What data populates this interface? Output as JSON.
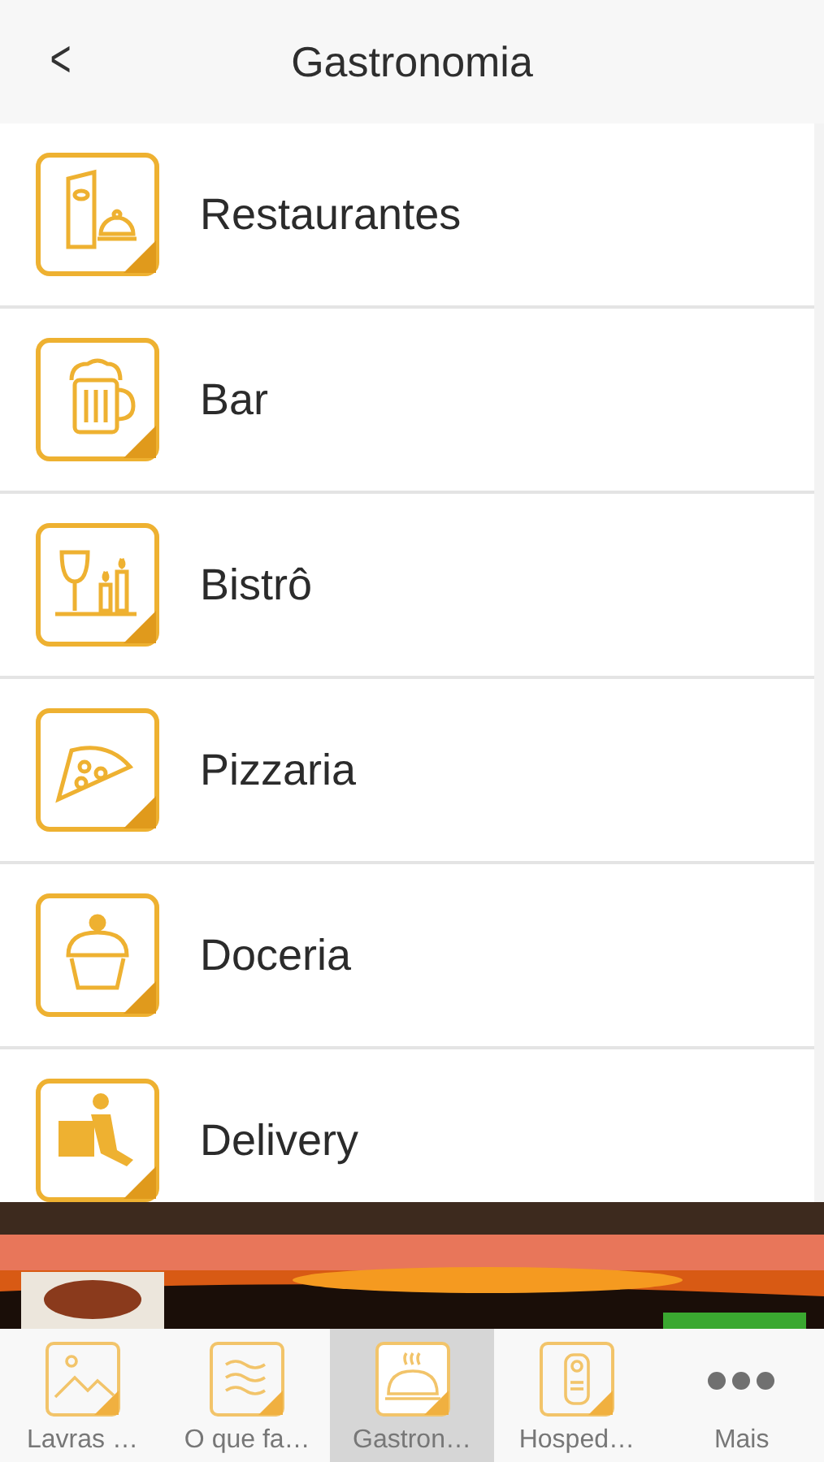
{
  "header": {
    "back": "<",
    "title": "Gastronomia"
  },
  "items": [
    {
      "label": "Restaurantes"
    },
    {
      "label": "Bar"
    },
    {
      "label": "Bistrô"
    },
    {
      "label": "Pizzaria"
    },
    {
      "label": "Doceria"
    },
    {
      "label": "Delivery"
    }
  ],
  "tabs": [
    {
      "label": "Lavras …",
      "selected": false
    },
    {
      "label": "O que fa…",
      "selected": false
    },
    {
      "label": "Gastron…",
      "selected": true
    },
    {
      "label": "Hosped…",
      "selected": false
    },
    {
      "label": "Mais",
      "selected": false
    }
  ]
}
